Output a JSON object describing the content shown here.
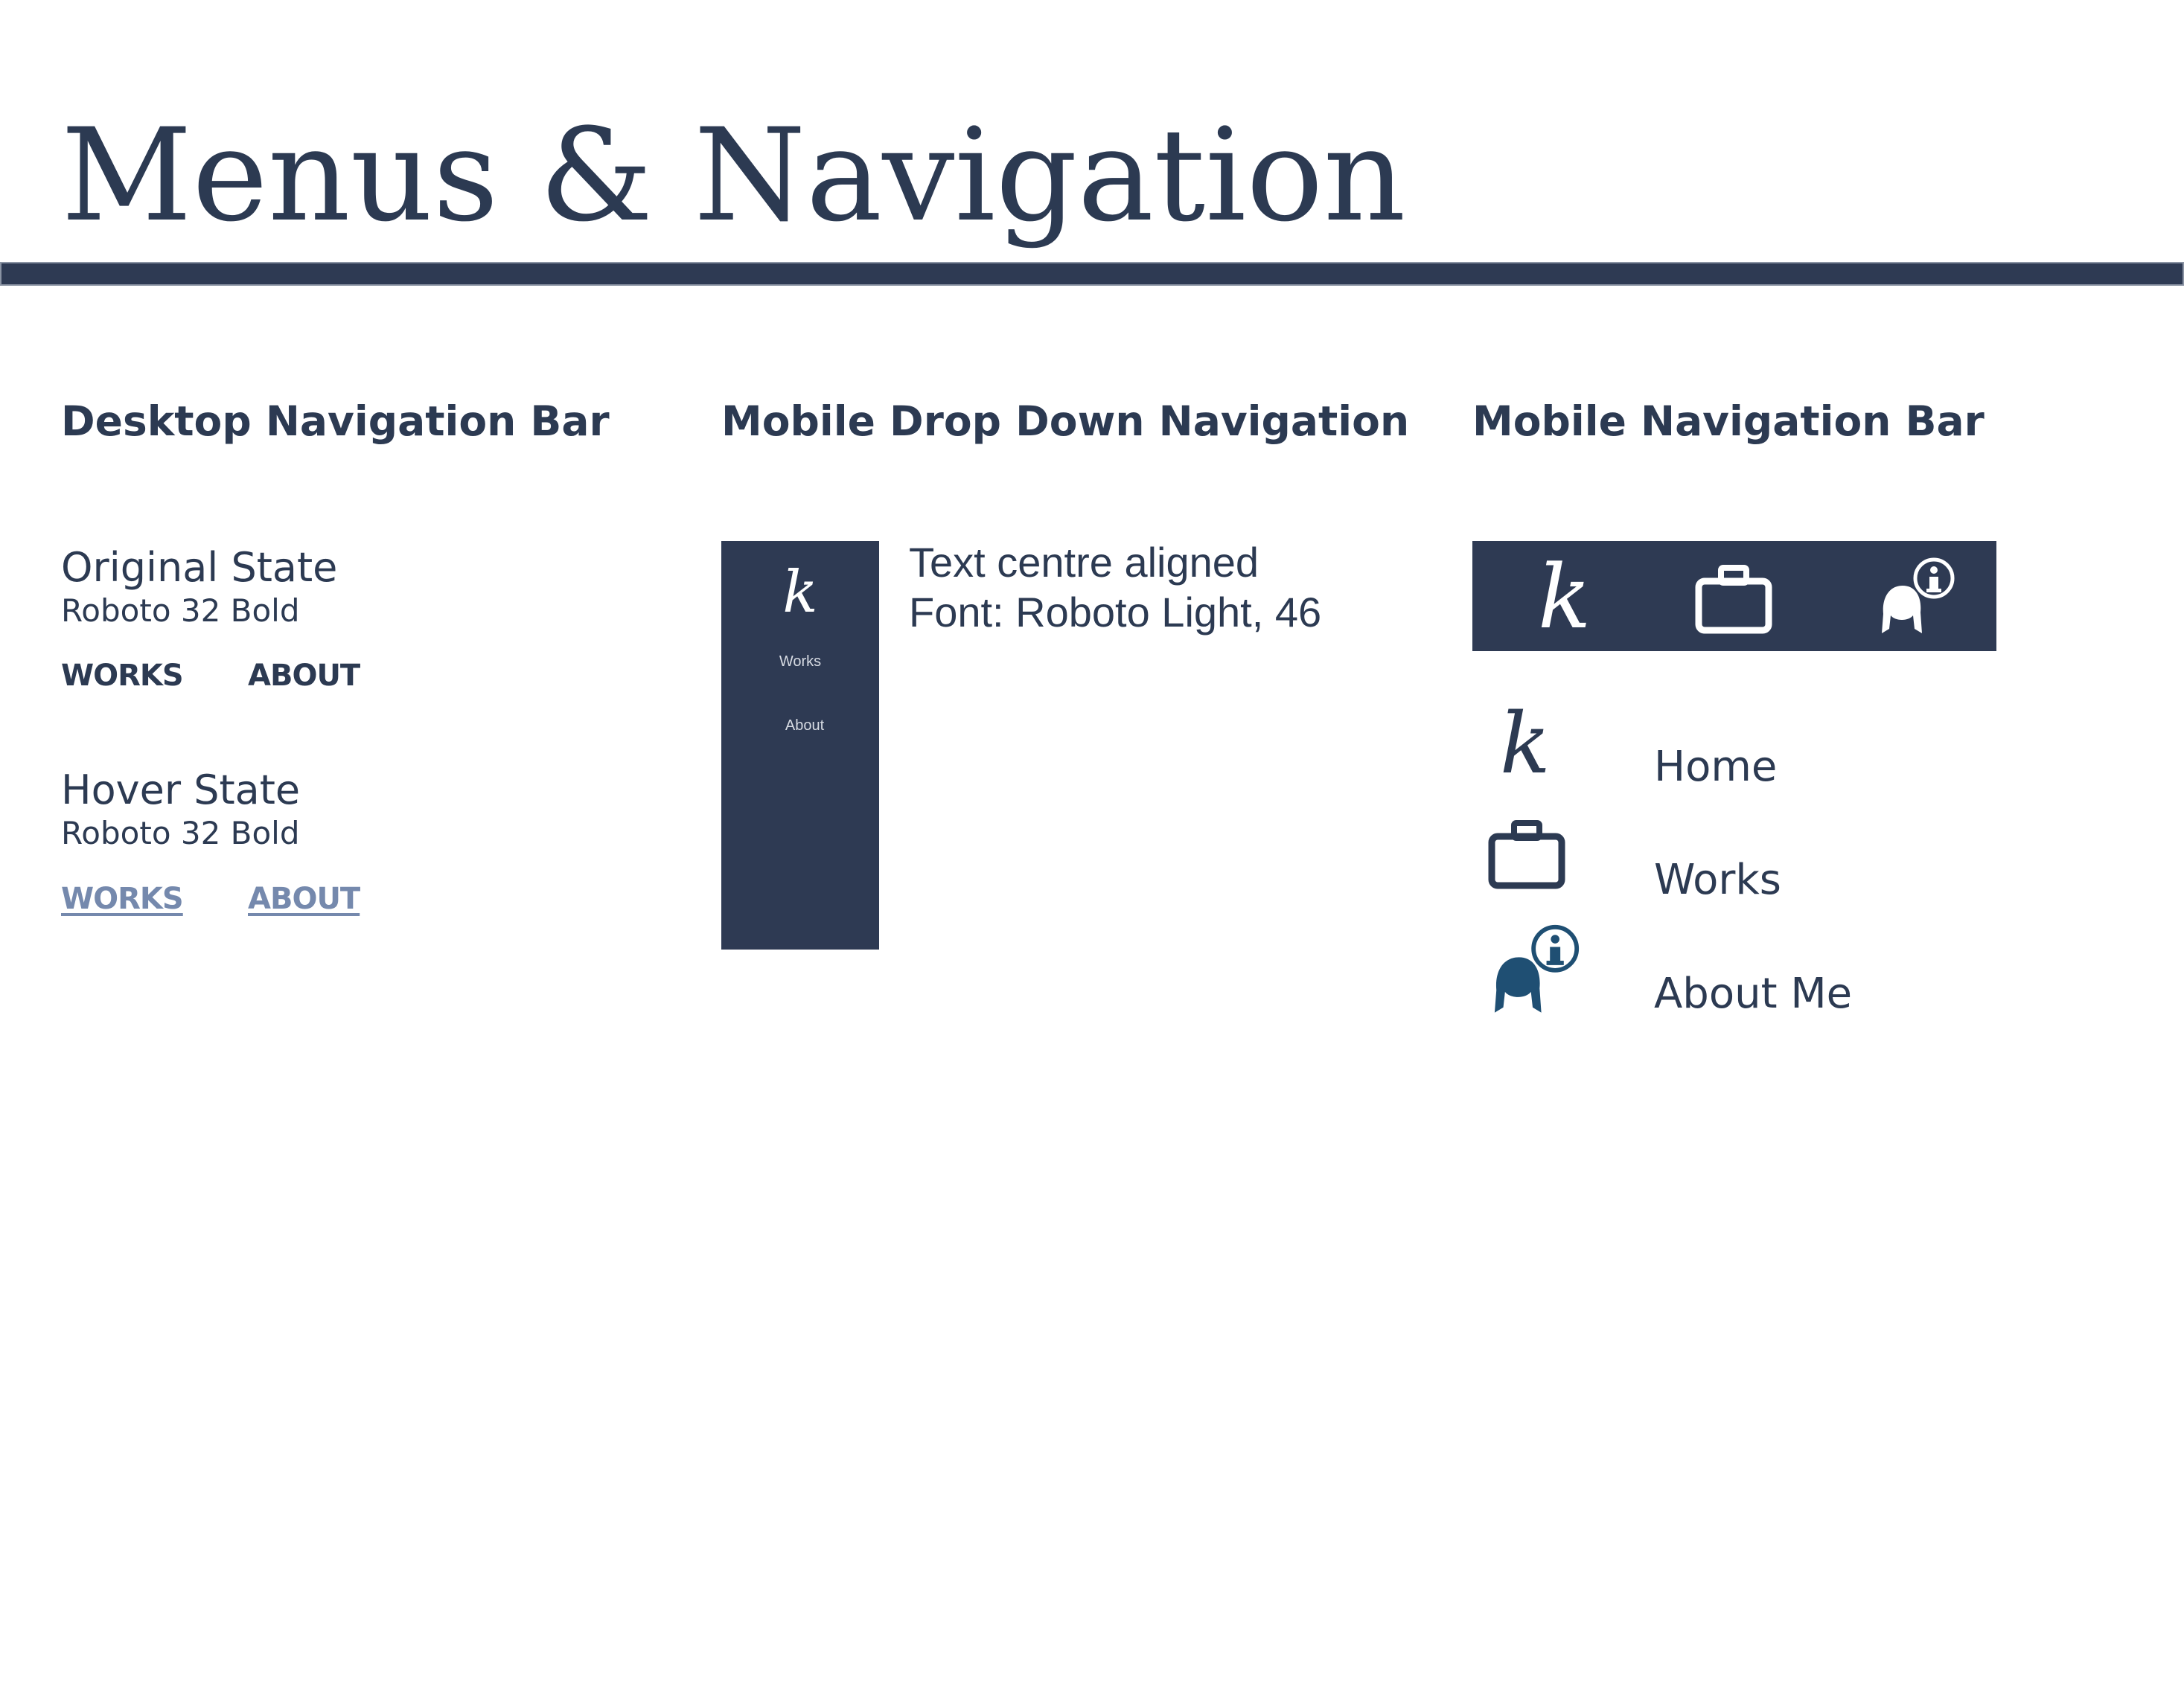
{
  "page": {
    "title": "Menus & Navigation"
  },
  "sections": {
    "desktop": {
      "heading": "Desktop Navigation Bar",
      "original": {
        "title": "Original State",
        "font": "Roboto 32 Bold",
        "links": [
          "WORKS",
          "ABOUT"
        ]
      },
      "hover": {
        "title": "Hover State",
        "font": "Roboto 32 Bold",
        "links": [
          "WORKS",
          "ABOUT"
        ]
      }
    },
    "dropdown": {
      "heading": "Mobile Drop Down Navigation",
      "logo": "k",
      "items": [
        "Works",
        "About"
      ],
      "note_line1": "Text centre aligned",
      "note_line2": "Font: Roboto Light, 46"
    },
    "mobile_bar": {
      "heading": "Mobile Navigation Bar",
      "bar_icons": [
        "k-logo-icon",
        "briefcase-icon",
        "about-person-icon"
      ],
      "list": [
        {
          "icon": "k-logo-icon",
          "label": "Home"
        },
        {
          "icon": "briefcase-icon",
          "label": "Works"
        },
        {
          "icon": "about-person-icon",
          "label": "About Me"
        }
      ],
      "logo": "k"
    }
  },
  "colors": {
    "navy": "#2e3a53",
    "text": "#2c3a52",
    "hover": "#7589ad",
    "icon_blue": "#1f4f73"
  }
}
